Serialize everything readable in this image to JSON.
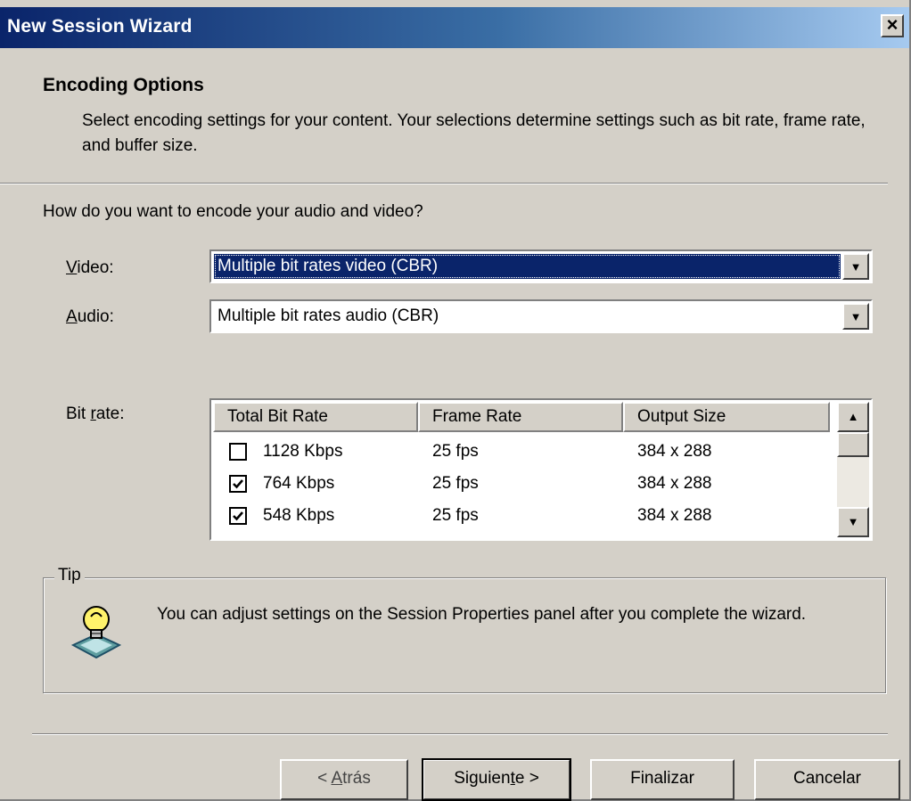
{
  "window": {
    "title": "New Session Wizard",
    "close_glyph": "×"
  },
  "header": {
    "title": "Encoding Options",
    "description": "Select encoding settings for your content. Your selections determine settings such as bit rate, frame rate, and buffer size."
  },
  "form": {
    "question": "How do you want to encode your audio and video?",
    "video": {
      "label_key": "V",
      "label_rest": "ideo:",
      "value": "Multiple bit rates video (CBR)"
    },
    "audio": {
      "label_key": "A",
      "label_rest": "udio:",
      "value": "Multiple bit rates audio (CBR)"
    },
    "bitrate": {
      "label_pre": "Bit ",
      "label_key": "r",
      "label_rest": "ate:"
    }
  },
  "bitrate_table": {
    "columns": [
      "Total Bit Rate",
      "Frame Rate",
      "Output Size"
    ],
    "rows": [
      {
        "checked": false,
        "bitrate": "1128 Kbps",
        "framerate": "25 fps",
        "size": "384 x 288"
      },
      {
        "checked": true,
        "bitrate": "764 Kbps",
        "framerate": "25 fps",
        "size": "384 x 288"
      },
      {
        "checked": true,
        "bitrate": "548 Kbps",
        "framerate": "25 fps",
        "size": "384 x 288"
      }
    ]
  },
  "tip": {
    "legend": "Tip",
    "text": "You can adjust settings on the Session Properties panel after you complete the wizard.",
    "icon": "lightbulb-icon"
  },
  "buttons": {
    "back_pre": "< ",
    "back_key": "A",
    "back_rest": "trás",
    "next_pre": "Siguien",
    "next_key": "t",
    "next_rest": "e >",
    "finish": "Finalizar",
    "cancel": "Cancelar"
  },
  "colors": {
    "title_start": "#0a246a",
    "title_end": "#a6caf0",
    "face": "#d4d0c8",
    "selection": "#0a246a"
  }
}
